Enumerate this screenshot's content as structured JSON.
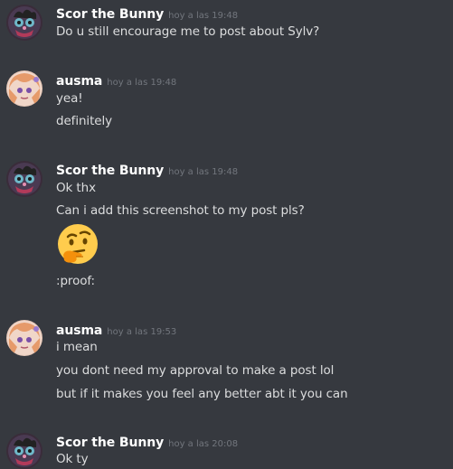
{
  "messages": [
    {
      "author": "Scor the Bunny",
      "timestamp": "hoy a las 19:48",
      "lines": [
        "Do u still encourage me to post about Sylv?"
      ]
    },
    {
      "author": "ausma",
      "timestamp": "hoy a las 19:48",
      "lines": [
        "yea!",
        "definitely"
      ]
    },
    {
      "author": "Scor the Bunny",
      "timestamp": "hoy a las 19:48",
      "lines": [
        "Ok thx",
        "Can i add this screenshot to my post pls?",
        ":proof:"
      ],
      "emoji": "thinking-face"
    },
    {
      "author": "ausma",
      "timestamp": "hoy a las 19:53",
      "lines": [
        "i mean",
        "you dont need my approval to make a post lol",
        "but if it makes you feel any better abt it you can"
      ]
    },
    {
      "author": "Scor the Bunny",
      "timestamp": "hoy a las 20:08",
      "lines": [
        "Ok ty"
      ]
    }
  ],
  "colors": {
    "background": "#36393f",
    "username": "#ffffff",
    "timestamp": "#72767d",
    "text": "#dcddde"
  }
}
